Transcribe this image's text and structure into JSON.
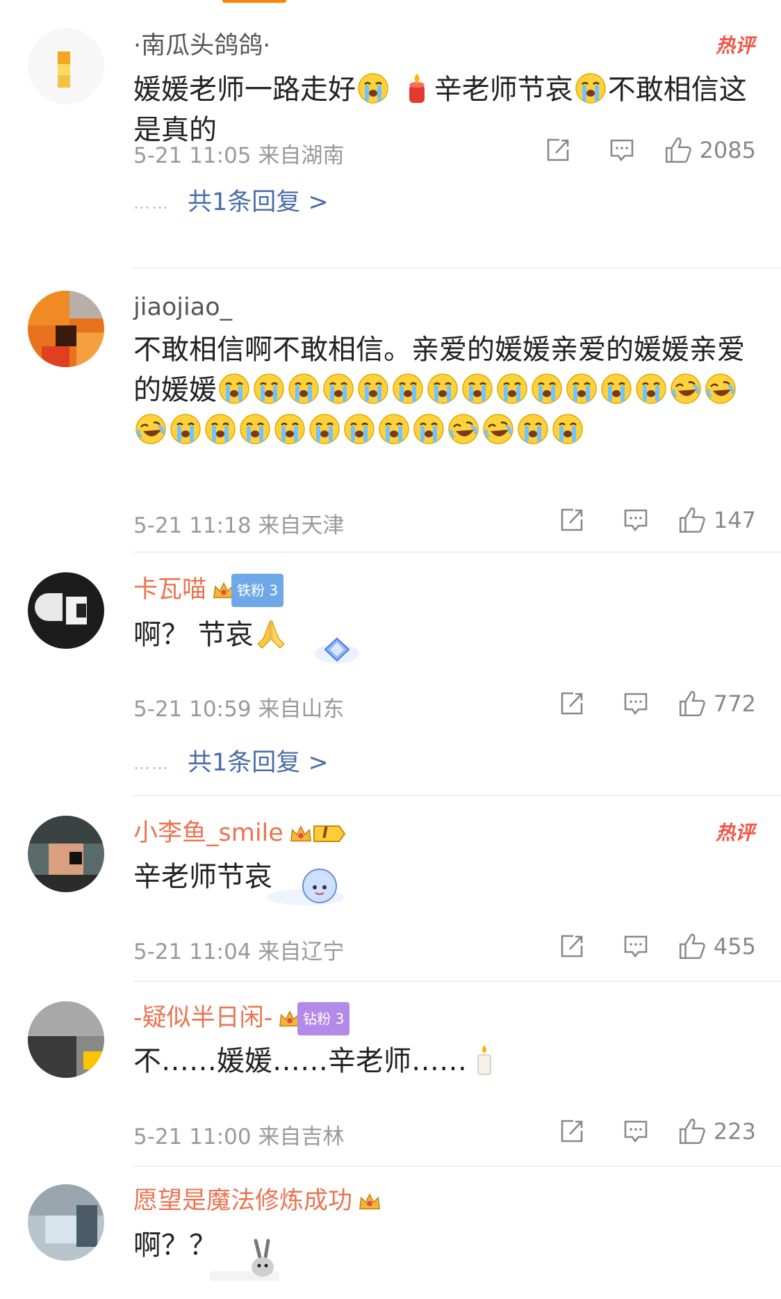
{
  "comments": [
    {
      "username": "·南瓜头鸽鸽·",
      "text": "媛媛老师一路走好",
      "text2": "辛老师节哀",
      "text3": "不敢相信这是真的",
      "time_location": "5-21 11:05  来自湖南",
      "likes": "2085",
      "replies": "共1条回复 >",
      "hot_label": "热评"
    },
    {
      "username": "jiaojiao_",
      "text": "不敢相信啊不敢相信。亲爱的媛媛亲爱的媛媛亲爱的媛媛",
      "time_location": "5-21 11:18  来自天津",
      "likes": "147"
    },
    {
      "username": "卡瓦喵",
      "fan_badge": "铁粉 3",
      "text": "啊？ 节哀",
      "time_location": "5-21 10:59  来自山东",
      "likes": "772",
      "replies": "共1条回复 >"
    },
    {
      "username": "小李鱼_smile",
      "level_badge": "I",
      "text": "辛老师节哀",
      "time_location": "5-21 11:04  来自辽宁",
      "likes": "455",
      "hot_label": "热评"
    },
    {
      "username": "-疑似半日闲-",
      "fan_badge": "钻粉 3",
      "text": "不……媛媛……辛老师……",
      "time_location": "5-21 11:00  来自吉林",
      "likes": "223"
    },
    {
      "username": "愿望是魔法修炼成功",
      "text": "啊？？"
    }
  ],
  "icons": {
    "repost": "repost-icon",
    "comment": "comment-icon",
    "like": "like-icon",
    "crying_emoji": "crying-face-icon",
    "laugh_cry_emoji": "laugh-cry-icon",
    "candle": "candle-icon",
    "pray": "pray-hands-icon",
    "crown": "crown-icon"
  },
  "colors": {
    "accent": "#ff8200",
    "link": "#4a6ea9",
    "vip_name": "#eb7350",
    "hot": "#f25447",
    "meta": "#999999"
  }
}
